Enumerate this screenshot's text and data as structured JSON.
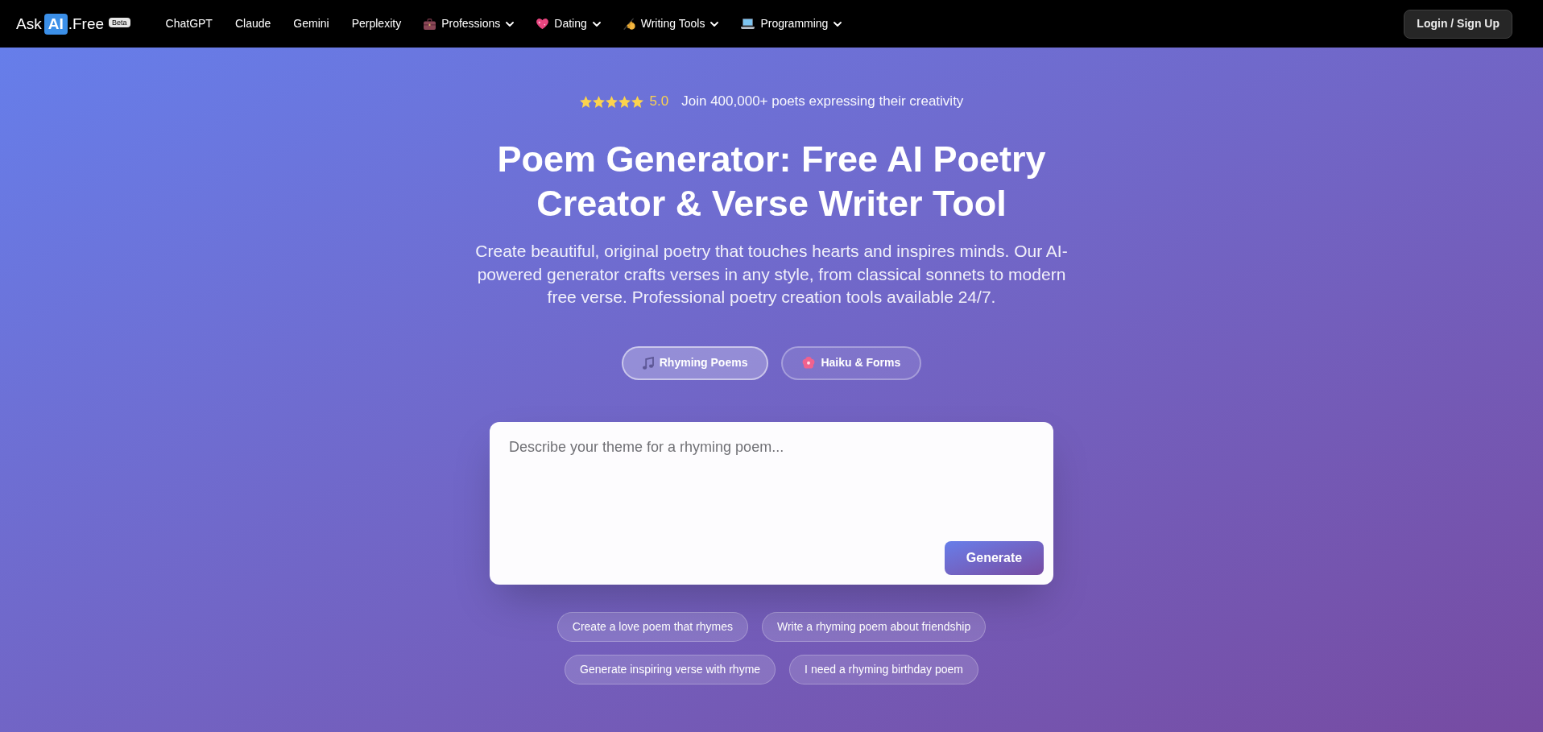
{
  "nav": {
    "logo": {
      "text": "Ask",
      "highlight": "AI",
      "suffix": ".Free",
      "badge": "Beta"
    },
    "links": [
      {
        "label": "ChatGPT",
        "kind": "link"
      },
      {
        "label": "Claude",
        "kind": "link"
      },
      {
        "label": "Gemini",
        "kind": "link"
      },
      {
        "label": "Perplexity",
        "kind": "link"
      },
      {
        "label": "Professions",
        "kind": "dropdown"
      },
      {
        "label": "Dating",
        "kind": "dropdown"
      },
      {
        "label": "Writing Tools",
        "kind": "dropdown"
      },
      {
        "label": "Programming",
        "kind": "dropdown"
      }
    ],
    "login_button": "Login / Sign Up"
  },
  "hero": {
    "rating": {
      "stars": 5,
      "score": "5.0",
      "text": "Join 400,000+ poets expressing their creativity"
    },
    "title": "Poem Generator: Free AI Poetry Creator & Verse Writer Tool",
    "subtitle": "Create beautiful, original poetry that touches hearts and inspires minds. Our AI-powered generator crafts verses in any style, from classical sonnets to modern free verse. Professional poetry creation tools available 24/7."
  },
  "tabs": [
    {
      "label": "Rhyming Poems",
      "selected": true
    },
    {
      "label": "Haiku & Forms",
      "selected": false
    }
  ],
  "prompt": {
    "placeholder": "Describe your theme for a rhyming poem...",
    "button": "Generate"
  },
  "suggestions": [
    "Create a love poem that rhymes",
    "Write a rhyming poem about friendship",
    "Generate inspiring verse with rhyme",
    "I need a rhyming birthday poem"
  ]
}
